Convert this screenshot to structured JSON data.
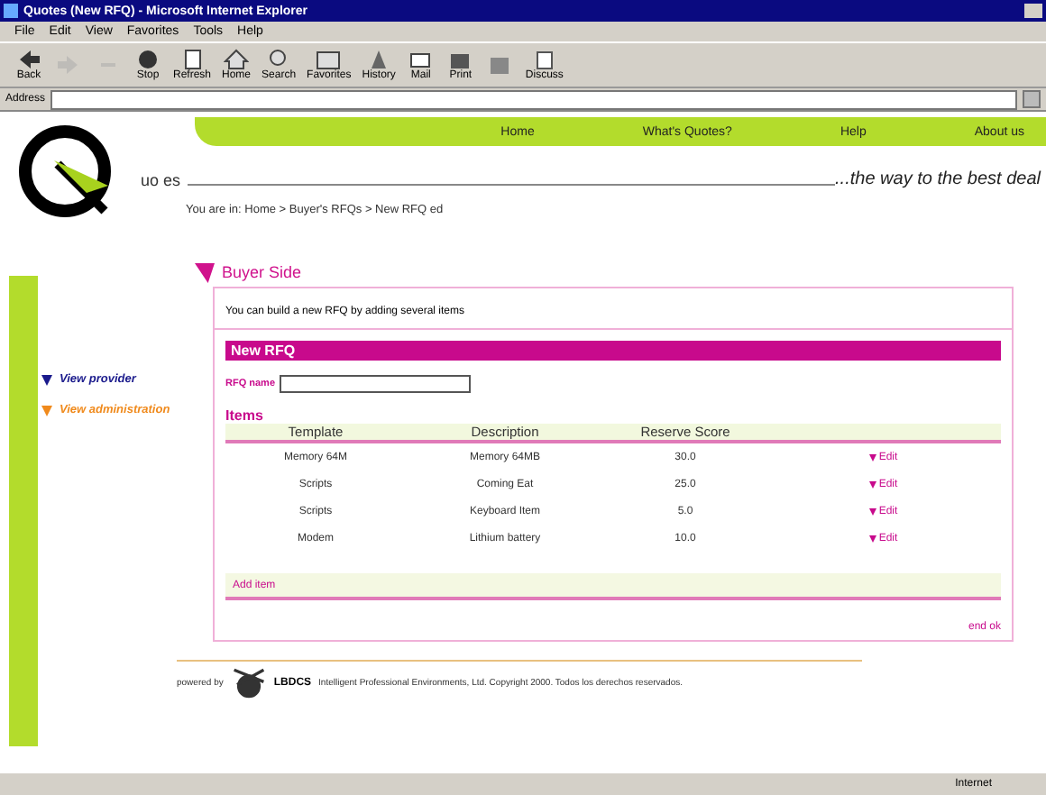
{
  "window": {
    "title": "Quotes (New RFQ) - Microsoft Internet Explorer"
  },
  "menu": [
    "File",
    "Edit",
    "View",
    "Favorites",
    "Tools",
    "Help"
  ],
  "toolbar": [
    {
      "label": "Back",
      "kind": "back",
      "disabled": false
    },
    {
      "kind": "forward",
      "disabled": true
    },
    {
      "kind": "dash",
      "disabled": true
    },
    {
      "label": "Stop",
      "kind": "stop",
      "disabled": false
    },
    {
      "label": "Refresh",
      "kind": "refresh",
      "disabled": false
    },
    {
      "label": "Home",
      "kind": "home",
      "disabled": false
    },
    {
      "label": "Search",
      "kind": "search",
      "disabled": false
    },
    {
      "label": "Favorites",
      "kind": "favorites",
      "disabled": false
    },
    {
      "label": "History",
      "kind": "history",
      "disabled": false
    },
    {
      "label": "Mail",
      "kind": "mail",
      "disabled": false
    },
    {
      "label": "Print",
      "kind": "print",
      "disabled": false
    },
    {
      "kind": "edit",
      "disabled": false
    },
    {
      "label": "Discuss",
      "kind": "discuss",
      "disabled": false
    }
  ],
  "address": {
    "label": "Address"
  },
  "nav": [
    "Home",
    "What's Quotes?",
    "Help",
    "About us"
  ],
  "logo": {
    "text": "uo es"
  },
  "tagline": "...the way to the best deal",
  "breadcrumb": "You are in:  Home > Buyer's RFQs > New RFQ ed",
  "sidebar": [
    {
      "label": "View provider",
      "kind": "provider"
    },
    {
      "label": "View administration",
      "kind": "admin"
    }
  ],
  "section_title": "Buyer Side",
  "intro": "You can build a new RFQ by adding several items",
  "form": {
    "title": "New RFQ",
    "field_label": "RFQ name"
  },
  "items": {
    "title": "Items",
    "columns": [
      "Template",
      "Description",
      "Reserve Score"
    ],
    "rows": [
      {
        "cells": [
          "Memory 64M",
          "Memory 64MB",
          "30.0"
        ],
        "action": "Edit"
      },
      {
        "cells": [
          "Scripts",
          "Coming Eat",
          "25.0"
        ],
        "action": "Edit"
      },
      {
        "cells": [
          "Scripts",
          "Keyboard Item",
          "5.0"
        ],
        "action": "Edit"
      },
      {
        "cells": [
          "Modem",
          "Lithium battery",
          "10.0"
        ],
        "action": "Edit"
      }
    ],
    "add": "Add item"
  },
  "end_link": "end ok",
  "footer": {
    "powered": "powered by",
    "brand": "LBDCS",
    "text": "Intelligent Professional Environments, Ltd.  Copyright 2000. Todos los derechos reservados."
  },
  "status_bar": {
    "zone": "Internet"
  }
}
